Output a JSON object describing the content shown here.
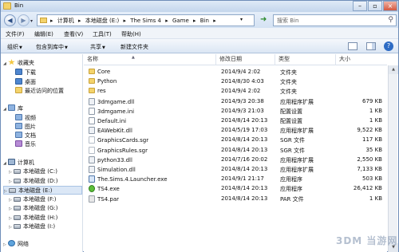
{
  "window": {
    "title": "Bin"
  },
  "address": {
    "crumbs": [
      "计算机",
      "本地磁盘 (E:)",
      "The Sims 4",
      "Game",
      "Bin"
    ],
    "separators": "▸"
  },
  "search": {
    "placeholder": "搜索 Bin"
  },
  "menu": [
    "文件(F)",
    "编辑(E)",
    "查看(V)",
    "工具(T)",
    "帮助(H)"
  ],
  "commands": {
    "organize": "组织",
    "include": "包含到库中",
    "share": "共享",
    "new_folder": "新建文件夹"
  },
  "nav": {
    "favorites": "收藏夹",
    "fav_items": [
      "下载",
      "桌面",
      "最近访问的位置"
    ],
    "libraries": "库",
    "lib_items": [
      "视频",
      "图片",
      "文档",
      "音乐"
    ],
    "computer": "计算机",
    "drives": [
      "本地磁盘 (C:)",
      "本地磁盘 (D:)",
      "本地磁盘 (E:)",
      "本地磁盘 (F:)",
      "本地磁盘 (G:)",
      "本地磁盘 (H:)",
      "本地磁盘 (I:)"
    ],
    "network": "网络"
  },
  "columns": {
    "name": "名称",
    "date": "修改日期",
    "type": "类型",
    "size": "大小"
  },
  "files": [
    {
      "name": "Core",
      "date": "2014/9/4 2:02",
      "type": "文件夹",
      "size": "",
      "icon": "folder"
    },
    {
      "name": "Python",
      "date": "2014/8/30 4:03",
      "type": "文件夹",
      "size": "",
      "icon": "folder"
    },
    {
      "name": "res",
      "date": "2014/9/4 2:02",
      "type": "文件夹",
      "size": "",
      "icon": "folder"
    },
    {
      "name": "3dmgame.dll",
      "date": "2014/9/3 20:38",
      "type": "应用程序扩展",
      "size": "679 KB",
      "icon": "dll"
    },
    {
      "name": "3dmgame.ini",
      "date": "2014/9/3 21:03",
      "type": "配置设置",
      "size": "1 KB",
      "icon": "ini"
    },
    {
      "name": "Default.ini",
      "date": "2014/8/14 20:13",
      "type": "配置设置",
      "size": "1 KB",
      "icon": "ini"
    },
    {
      "name": "EAWebKit.dll",
      "date": "2014/5/19 17:03",
      "type": "应用程序扩展",
      "size": "9,522 KB",
      "icon": "dll"
    },
    {
      "name": "GraphicsCards.sgr",
      "date": "2014/8/14 20:13",
      "type": "SGR 文件",
      "size": "117 KB",
      "icon": "sgr"
    },
    {
      "name": "GraphicsRules.sgr",
      "date": "2014/8/14 20:13",
      "type": "SGR 文件",
      "size": "35 KB",
      "icon": "sgr"
    },
    {
      "name": "python33.dll",
      "date": "2014/7/16 20:02",
      "type": "应用程序扩展",
      "size": "2,550 KB",
      "icon": "dll"
    },
    {
      "name": "Simulation.dll",
      "date": "2014/8/14 20:13",
      "type": "应用程序扩展",
      "size": "7,133 KB",
      "icon": "dll"
    },
    {
      "name": "The.Sims.4.Launcher.exe",
      "date": "2014/9/1 21:17",
      "type": "应用程序",
      "size": "503 KB",
      "icon": "exe"
    },
    {
      "name": "TS4.exe",
      "date": "2014/8/14 20:13",
      "type": "应用程序",
      "size": "26,412 KB",
      "icon": "ts4"
    },
    {
      "name": "TS4.par",
      "date": "2014/8/14 20:13",
      "type": "PAR 文件",
      "size": "1 KB",
      "icon": "par"
    }
  ],
  "watermark": "3DM 当游网"
}
